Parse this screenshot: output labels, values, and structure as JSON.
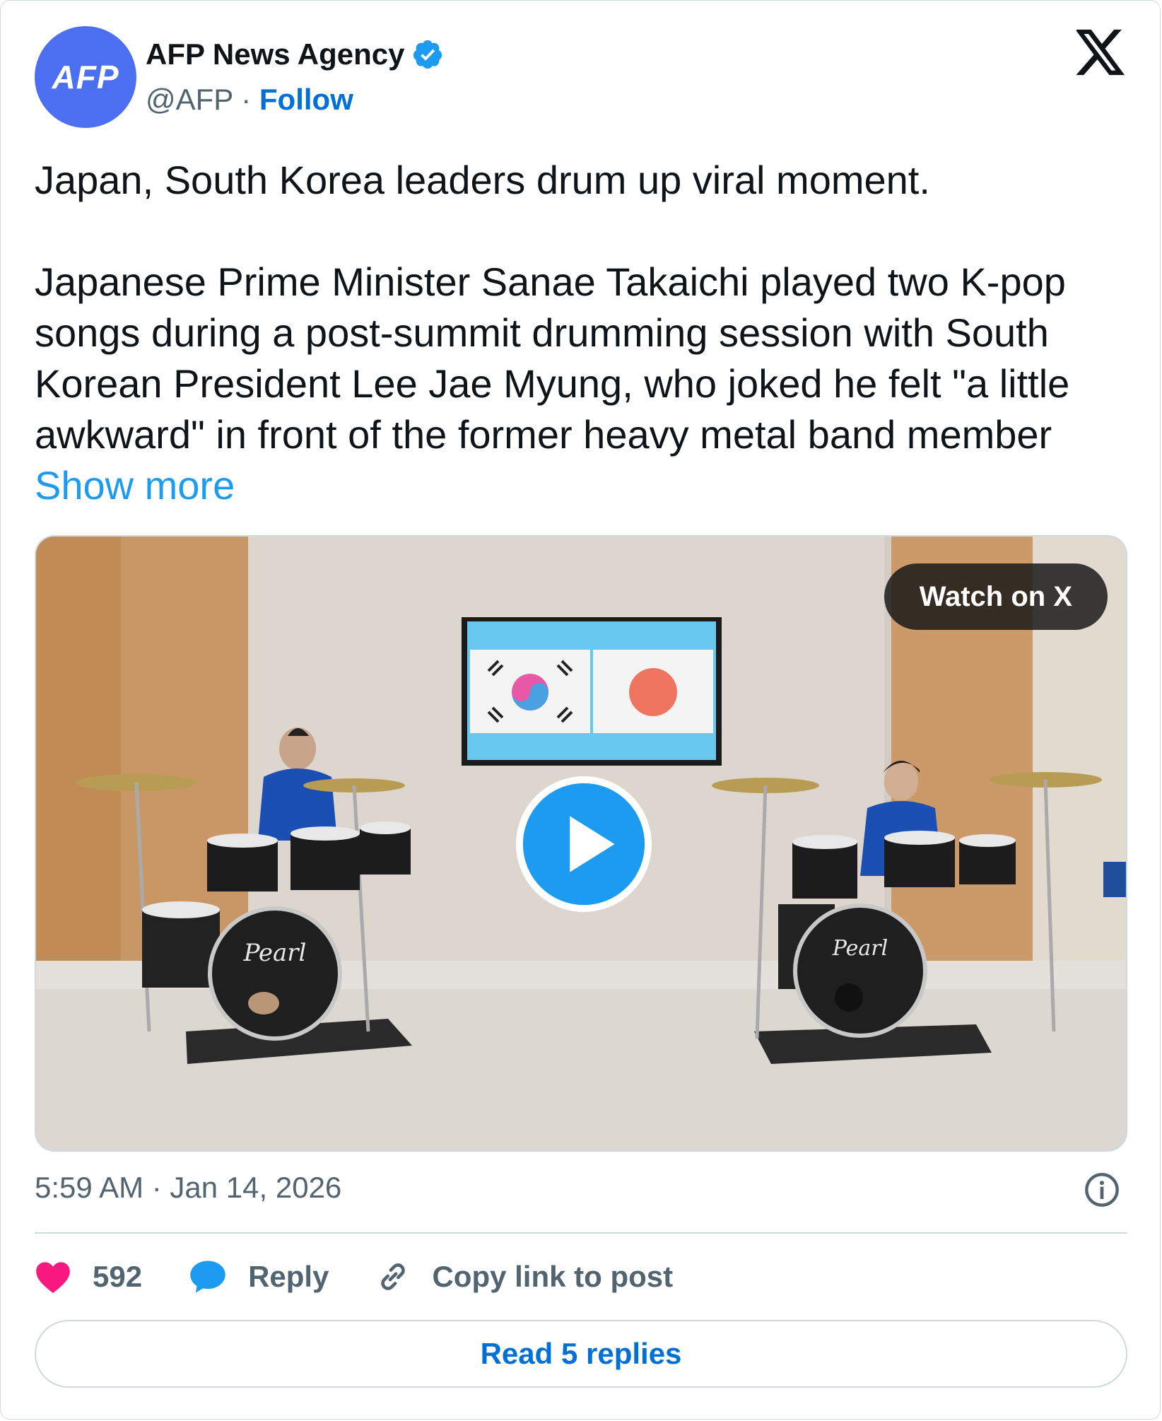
{
  "author": {
    "avatar_text": "AFP",
    "name": "AFP News Agency",
    "handle": "@AFP",
    "separator": " · ",
    "follow_label": "Follow"
  },
  "tweet": {
    "headline": "Japan, South Korea leaders drum up viral moment.",
    "body": "Japanese Prime Minister Sanae Takaichi played two K-pop songs during a post-summit drumming session with South Korean President Lee Jae Myung, who joked he felt \"a little awkward\" in front of the former heavy metal band member ",
    "show_more": "Show more"
  },
  "media": {
    "watch_label": "Watch on X",
    "drum_brand": "Pearl"
  },
  "timestamp": "5:59 AM · Jan 14, 2026",
  "actions": {
    "like_count": "592",
    "reply_label": "Reply",
    "copy_label": "Copy link to post"
  },
  "read_replies_label": "Read 5 replies",
  "colors": {
    "accent": "#1d9bf0",
    "link": "#006fd6",
    "like": "#f91880",
    "avatar": "#4b6ff0"
  },
  "icons": [
    "verified-badge-icon",
    "x-logo-icon",
    "play-icon",
    "info-icon",
    "heart-icon",
    "reply-bubble-icon",
    "link-icon"
  ]
}
